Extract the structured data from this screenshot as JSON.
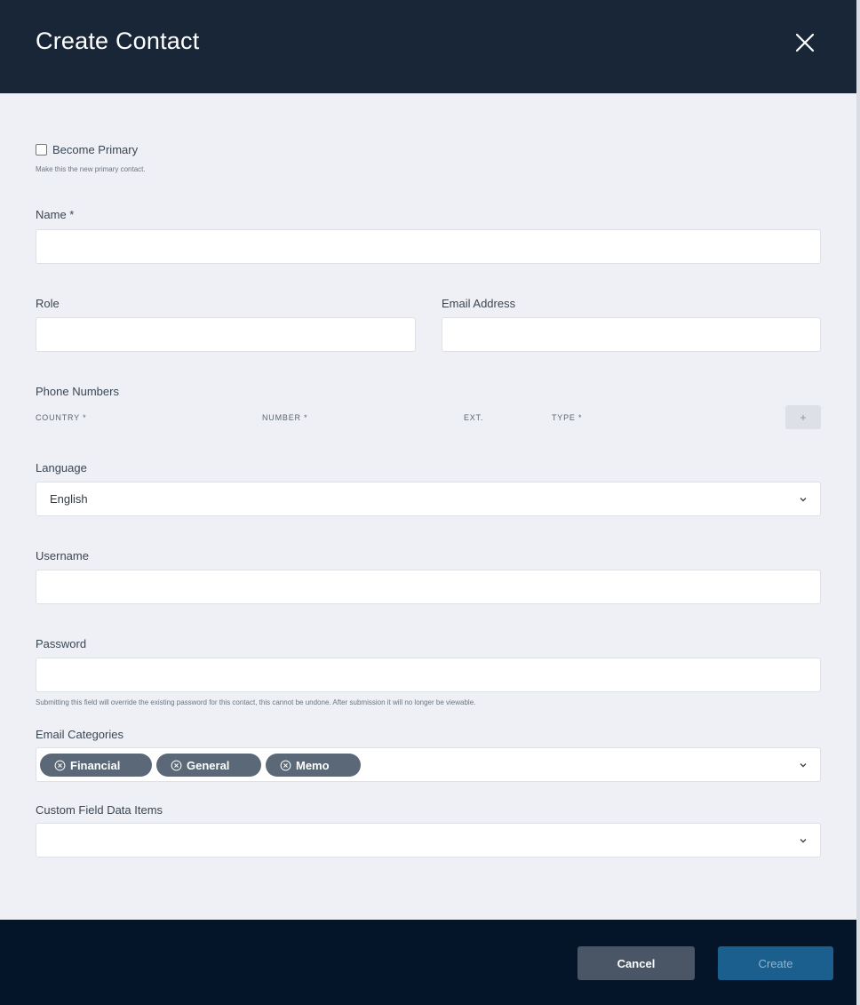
{
  "dialog": {
    "title": "Create Contact"
  },
  "become_primary": {
    "label": "Become Primary",
    "hint": "Make this the new primary contact.",
    "checked": false
  },
  "name": {
    "label": "Name *",
    "value": ""
  },
  "role": {
    "label": "Role",
    "value": ""
  },
  "email": {
    "label": "Email Address",
    "value": ""
  },
  "phone": {
    "label": "Phone Numbers",
    "columns": {
      "country": "COUNTRY *",
      "number": "NUMBER *",
      "ext": "EXT.",
      "type": "TYPE *"
    },
    "add_label": "+"
  },
  "language": {
    "label": "Language",
    "selected": "English"
  },
  "username": {
    "label": "Username",
    "value": ""
  },
  "password": {
    "label": "Password",
    "value": "",
    "hint": "Submitting this field will override the existing password for this contact, this cannot be undone. After submission it will no longer be viewable."
  },
  "email_categories": {
    "label": "Email Categories",
    "chips": [
      "Financial",
      "General",
      "Memo"
    ]
  },
  "custom_fields": {
    "label": "Custom Field Data Items",
    "selected": ""
  },
  "footer": {
    "cancel_label": "Cancel",
    "create_label": "Create"
  },
  "colors": {
    "header_bg": "#192638",
    "footer_bg": "#04152a",
    "chip_bg": "#5a6878",
    "create_bg": "#1b5f8e",
    "cancel_bg": "#4a5565"
  }
}
